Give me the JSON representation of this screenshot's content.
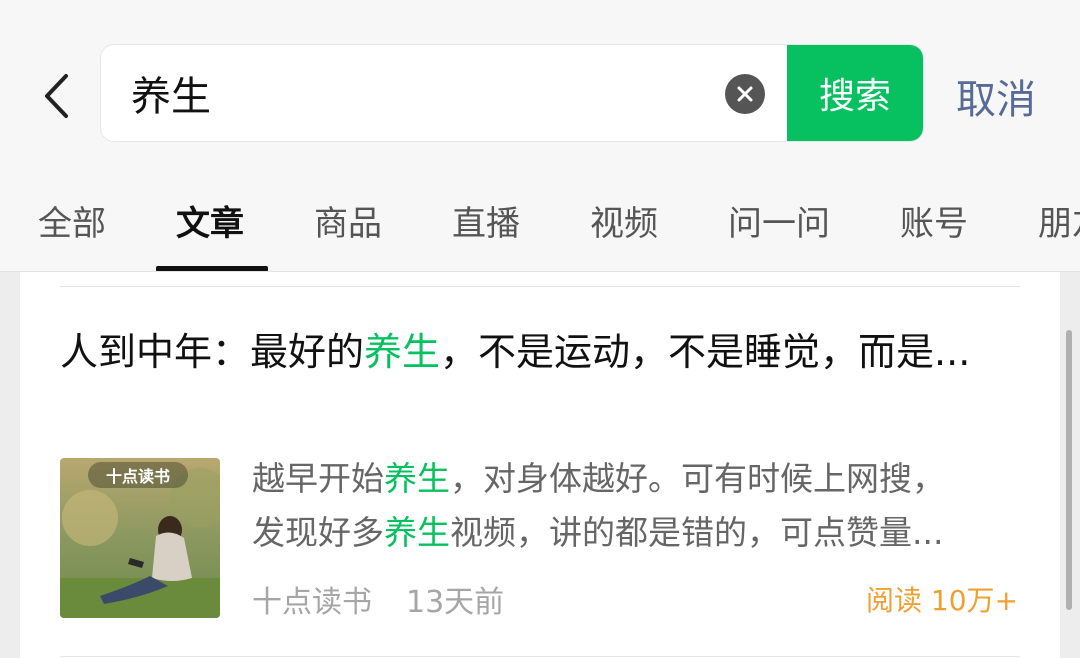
{
  "header": {
    "search_value": "养生",
    "search_button": "搜索",
    "cancel": "取消"
  },
  "tabs": [
    {
      "label": "全部",
      "active": false
    },
    {
      "label": "文章",
      "active": true
    },
    {
      "label": "商品",
      "active": false
    },
    {
      "label": "直播",
      "active": false
    },
    {
      "label": "视频",
      "active": false
    },
    {
      "label": "问一问",
      "active": false
    },
    {
      "label": "账号",
      "active": false
    },
    {
      "label": "朋友圈",
      "active": false
    }
  ],
  "result": {
    "title_parts": [
      "人到中年：最好的",
      "养生",
      "，不是运动，不是睡觉，而是..."
    ],
    "snippet_line1_parts": [
      "越早开始",
      "养生",
      "，对身体越好。可有时候上网搜，"
    ],
    "snippet_line2_parts": [
      "发现好多",
      "养生",
      "视频，讲的都是错的，可点赞量..."
    ],
    "thumbnail_brand": "十点读书",
    "source": "十点读书",
    "time": "13天前",
    "read_count": "阅读 10万+"
  },
  "colors": {
    "accent_green": "#07c160",
    "link_blue": "#576b95",
    "read_orange": "#f0a030"
  },
  "icons": {
    "back": "chevron-left-icon",
    "clear": "clear-icon"
  }
}
